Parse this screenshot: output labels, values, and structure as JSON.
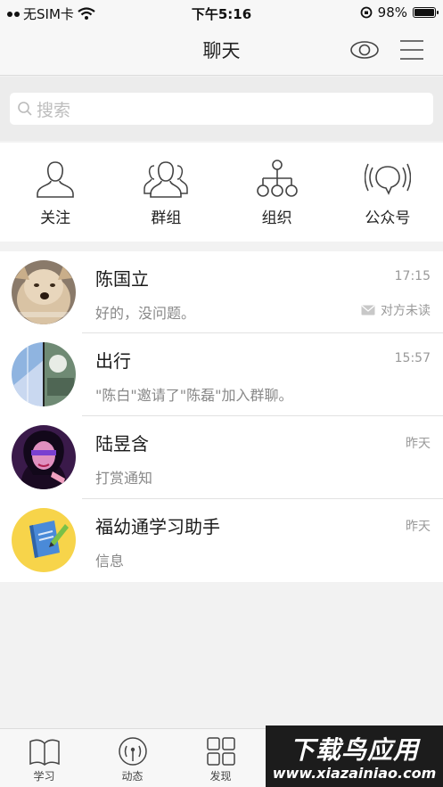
{
  "status_bar": {
    "carrier": "无SIM卡",
    "time": "下午5:16",
    "battery": "98%",
    "battery_level": 0.98
  },
  "header": {
    "title": "聊天",
    "right_icons": [
      "eye-icon",
      "menu-icon"
    ]
  },
  "search": {
    "placeholder": "搜索"
  },
  "quick_entries": [
    {
      "label": "关注",
      "icon": "person-icon"
    },
    {
      "label": "群组",
      "icon": "group-icon"
    },
    {
      "label": "组织",
      "icon": "org-chart-icon"
    },
    {
      "label": "公众号",
      "icon": "broadcast-bubble-icon"
    }
  ],
  "conversations": [
    {
      "name": "陈国立",
      "preview": "好的，没问题。",
      "time": "17:15",
      "status": "对方未读"
    },
    {
      "name": "出行",
      "preview": "\"陈白\"邀请了\"陈磊\"加入群聊。",
      "time": "15:57",
      "status": ""
    },
    {
      "name": "陆昱含",
      "preview": "打赏通知",
      "time": "昨天",
      "status": ""
    },
    {
      "name": "福幼通学习助手",
      "preview": "信息",
      "time": "昨天",
      "status": ""
    }
  ],
  "tab_bar": [
    {
      "label": "学习",
      "icon": "book-icon"
    },
    {
      "label": "动态",
      "icon": "signal-icon"
    },
    {
      "label": "发现",
      "icon": "grid-icon"
    }
  ],
  "watermark": {
    "top": "下载鸟应用",
    "bottom": "www.xiazainiao.com"
  },
  "colors": {
    "background": "#f2f2f2",
    "bar": "#f7f7f7",
    "text_primary": "#1a1a1a",
    "text_secondary": "#888888"
  }
}
